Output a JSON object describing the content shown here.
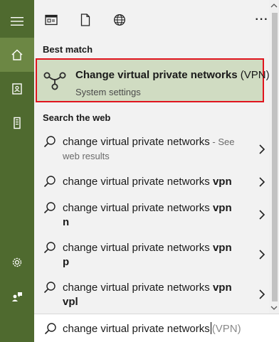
{
  "rail": {
    "items": [
      {
        "name": "menu-icon"
      },
      {
        "name": "home-icon"
      },
      {
        "name": "notebook-icon"
      },
      {
        "name": "device-icon"
      },
      {
        "name": "settings-icon"
      },
      {
        "name": "feedback-icon"
      }
    ]
  },
  "topbar": {
    "filters": [
      "apps-filter-icon",
      "documents-filter-icon",
      "web-filter-icon"
    ],
    "more_label": "···"
  },
  "best_match": {
    "section_label": "Best match",
    "title_bold": "Change virtual private networks",
    "title_rest": " (VPN)",
    "subtitle": "System settings",
    "icon": "vpn-icon"
  },
  "web": {
    "section_label": "Search the web",
    "items": [
      {
        "lines": [
          {
            "text": "change virtual private networks",
            "bold": "",
            "sub": " - See"
          },
          {
            "text": "",
            "bold": "",
            "sub": "web results"
          }
        ]
      },
      {
        "lines": [
          {
            "text": "change virtual private networks ",
            "bold": "vpn",
            "sub": ""
          }
        ]
      },
      {
        "lines": [
          {
            "text": "change virtual private networks ",
            "bold": "vpn",
            "sub": ""
          },
          {
            "text": "",
            "bold": "n",
            "sub": ""
          }
        ]
      },
      {
        "lines": [
          {
            "text": "change virtual private networks ",
            "bold": "vpn",
            "sub": ""
          },
          {
            "text": "",
            "bold": "p",
            "sub": ""
          }
        ]
      },
      {
        "lines": [
          {
            "text": "change virtual private networks ",
            "bold": "vpn",
            "sub": ""
          },
          {
            "text": "",
            "bold": "vpl",
            "sub": ""
          }
        ]
      }
    ]
  },
  "search": {
    "query": "change virtual private networks",
    "suggestion": "(VPN)"
  },
  "colors": {
    "accent": "#4f6a2f",
    "accent_active": "#6c8744",
    "best_match_bg": "#d0dcc2",
    "highlight_border": "#e0141e"
  }
}
